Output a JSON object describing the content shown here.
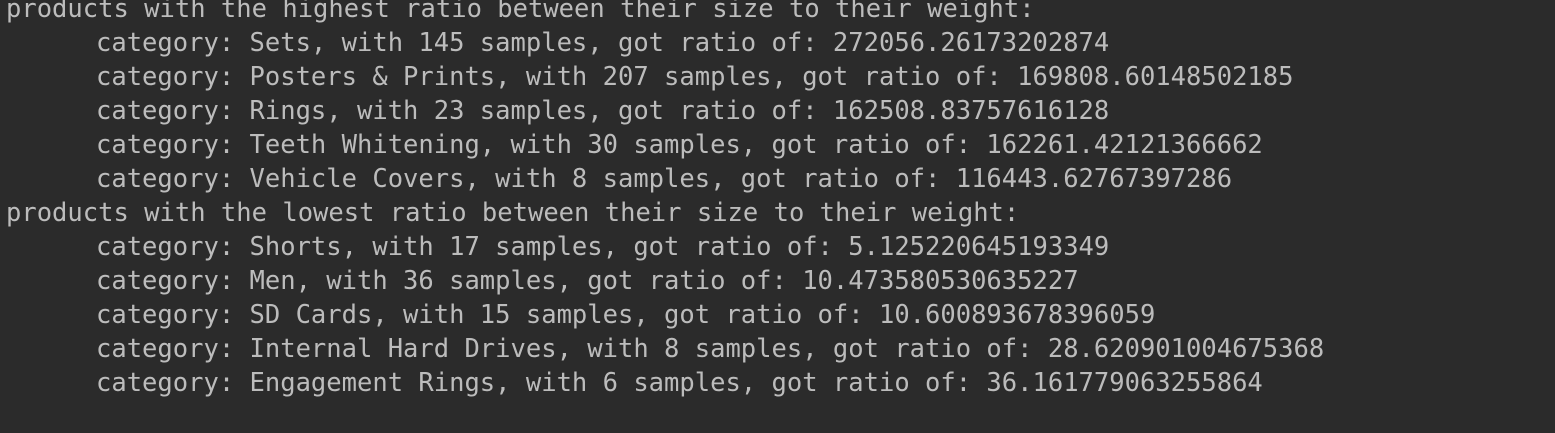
{
  "console": {
    "highest_header": "products with the highest ratio between their size to their weight:",
    "highest_items": [
      "category: Sets, with 145 samples, got ratio of: 272056.26173202874",
      "category: Posters & Prints, with 207 samples, got ratio of: 169808.60148502185",
      "category: Rings, with 23 samples, got ratio of: 162508.83757616128",
      "category: Teeth Whitening, with 30 samples, got ratio of: 162261.42121366662",
      "category: Vehicle Covers, with 8 samples, got ratio of: 116443.62767397286"
    ],
    "lowest_header": "products with the lowest ratio between their size to their weight:",
    "lowest_items": [
      "category: Shorts, with 17 samples, got ratio of: 5.125220645193349",
      "category: Men, with 36 samples, got ratio of: 10.473580530635227",
      "category: SD Cards, with 15 samples, got ratio of: 10.600893678396059",
      "category: Internal Hard Drives, with 8 samples, got ratio of: 28.620901004675368",
      "category: Engagement Rings, with 6 samples, got ratio of: 36.161779063255864"
    ]
  },
  "colors": {
    "background": "#2b2b2b",
    "text": "#bcbcbc"
  }
}
